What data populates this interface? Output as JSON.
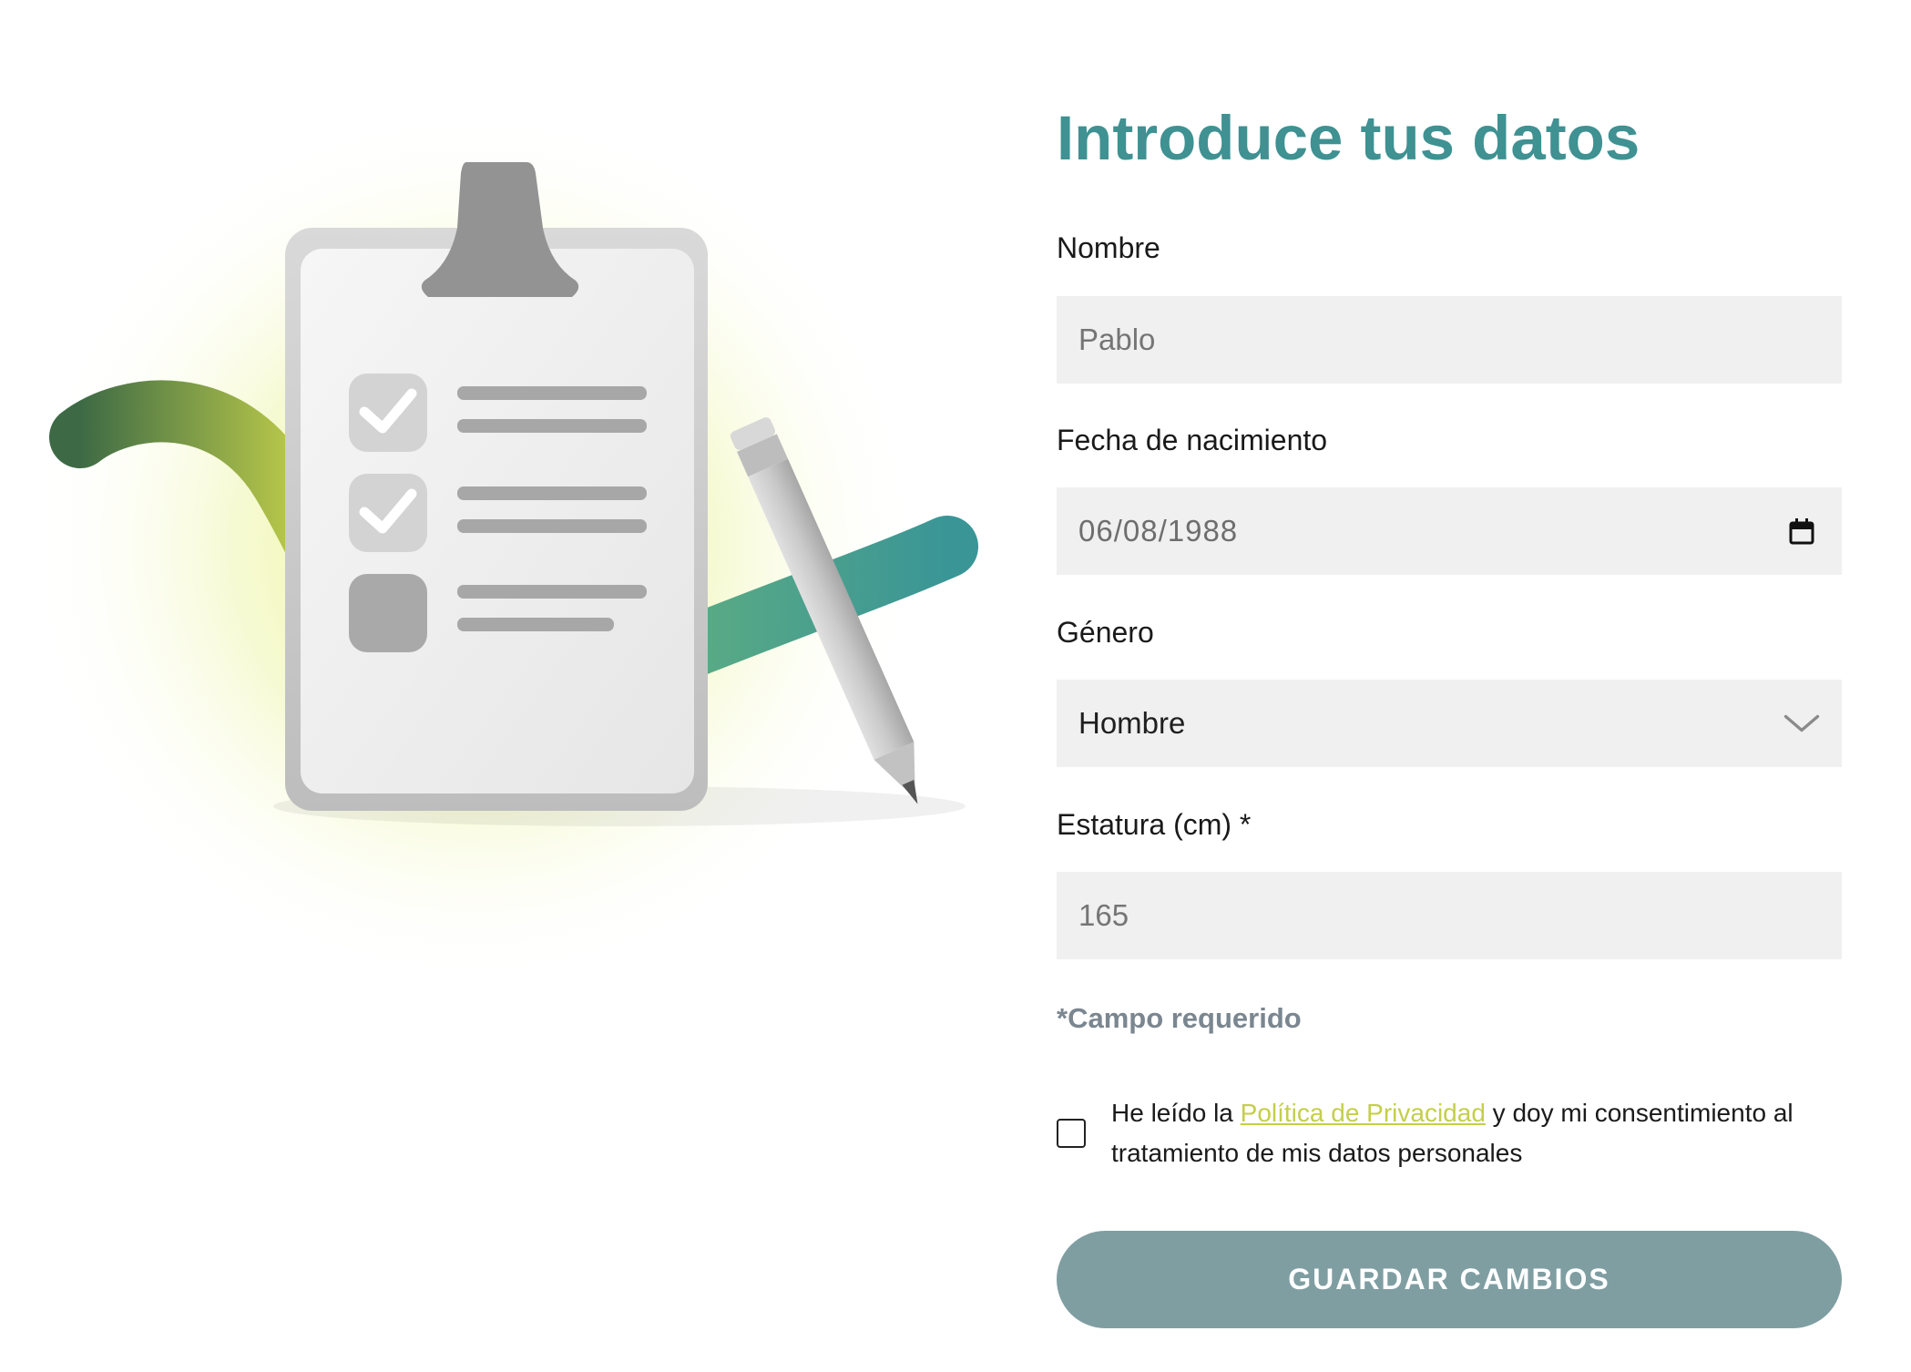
{
  "form": {
    "title": "Introduce tus datos",
    "fields": {
      "name": {
        "label": "Nombre",
        "placeholder": "Pablo"
      },
      "birthdate": {
        "label": "Fecha de nacimiento",
        "value": "06/08/1988"
      },
      "gender": {
        "label": "Género",
        "value": "Hombre"
      },
      "height": {
        "label": "Estatura (cm) *",
        "placeholder": "165"
      }
    },
    "required_note": "*Campo requerido",
    "consent": {
      "checked": false,
      "text_before": "He leído la ",
      "link_text": "Política de Privacidad",
      "text_after": " y doy mi consentimiento al tratamiento de mis datos personales"
    },
    "save_label": "GUARDAR CAMBIOS"
  },
  "icons": {
    "date": "calendar-icon",
    "select": "chevron-down-icon",
    "illustration": "clipboard-checklist-illustration"
  },
  "colors": {
    "title": "#3f9192",
    "button": "#7f9ea2",
    "link": "#c4cf4a",
    "field_bg": "#f0f0f0"
  }
}
